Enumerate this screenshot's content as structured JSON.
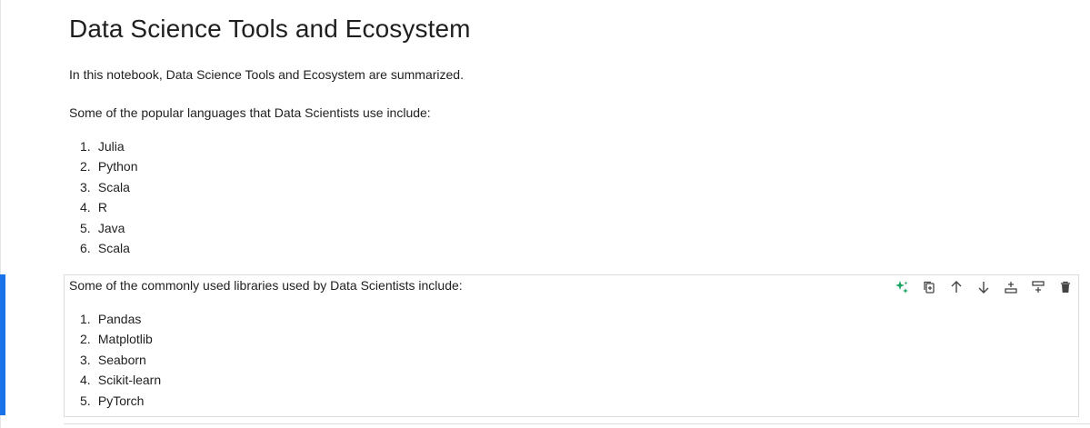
{
  "notebook": {
    "title": "Data Science Tools and Ecosystem",
    "intro": "In this notebook, Data Science Tools and Ecosystem are summarized.",
    "languages_intro": "Some of the popular languages that Data Scientists use include:",
    "languages": [
      {
        "num": "1.",
        "text": "Julia"
      },
      {
        "num": "2.",
        "text": "Python"
      },
      {
        "num": "3.",
        "text": "Scala"
      },
      {
        "num": "4.",
        "text": "R"
      },
      {
        "num": "5.",
        "text": "Java"
      },
      {
        "num": "6.",
        "text": "Scala"
      }
    ],
    "libraries_intro": "Some of the commonly used libraries used by Data Scientists include:",
    "libraries": [
      {
        "num": "1.",
        "text": "Pandas"
      },
      {
        "num": "2.",
        "text": "Matplotlib"
      },
      {
        "num": "3.",
        "text": "Seaborn"
      },
      {
        "num": "4.",
        "text": "Scikit-learn"
      },
      {
        "num": "5.",
        "text": "PyTorch"
      }
    ]
  },
  "cell_toolbar": {
    "icons": [
      "ai-sparkle-icon",
      "duplicate-icon",
      "move-up-icon",
      "move-down-icon",
      "insert-above-icon",
      "insert-below-icon",
      "delete-icon"
    ],
    "accent_color": "#1a73e8",
    "sparkle_color": "#1aa260"
  }
}
